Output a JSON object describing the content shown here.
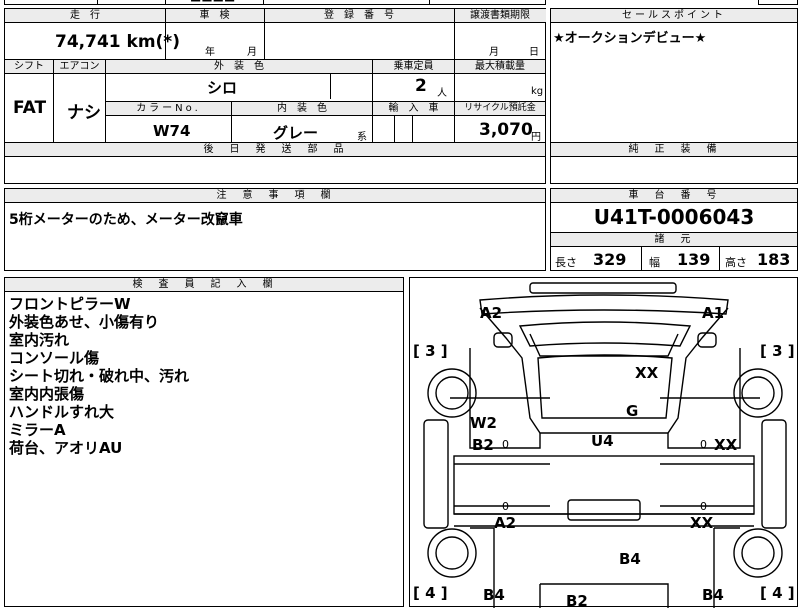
{
  "top_strip": {
    "partial_text": "■■■■"
  },
  "row1": {
    "mileage_label": "走　行",
    "mileage_value": "74,741 km(*)",
    "inspection_label": "車　検",
    "inspection_year": "年",
    "inspection_month": "月",
    "registration_label": "登　録　番　号",
    "registration_value": "",
    "transfer_label": "譲渡書類期限",
    "transfer_month": "月",
    "transfer_day": "日"
  },
  "row2": {
    "shift_label": "シフト",
    "shift_value": "FAT",
    "ac_label": "エアコン",
    "ac_value": "ナシ",
    "exterior_color_label": "外　装　色",
    "exterior_color_value": "シロ",
    "capacity_label": "乗車定員",
    "capacity_value": "2",
    "capacity_unit": "人",
    "max_load_label": "最大積載量",
    "max_load_unit": "kg",
    "color_no_label": "カラーNo.",
    "color_no_value": "W74",
    "interior_color_label": "内　装　色",
    "interior_color_value": "グレー",
    "interior_suffix": "系",
    "import_label": "輸　入　車",
    "recycle_label": "リサイクル預託金",
    "recycle_value": "3,070",
    "recycle_unit": "円"
  },
  "later_parts": {
    "label": "後　日　発　送　部　品",
    "value": ""
  },
  "sales_point": {
    "label": "セールスポイント",
    "value": "★オークションデビュー★"
  },
  "genuine_equipment": {
    "label": "純　正　装　備",
    "value": ""
  },
  "caution": {
    "label": "注　意　事　項　欄",
    "value": "5桁メーターのため、メーター改竄車"
  },
  "chassis": {
    "label": "車　台　番　号",
    "value": "U41T-0006043"
  },
  "specs": {
    "label": "諸　元",
    "length_label": "長さ",
    "length_value": "329",
    "width_label": "幅",
    "width_value": "139",
    "height_label": "高さ",
    "height_value": "183"
  },
  "inspector": {
    "label": "検　査　員　記　入　欄",
    "notes": [
      "フロントピラーW",
      "外装色あせ、小傷有り",
      "室内汚れ",
      "コンソール傷",
      "シート切れ・破れ中、汚れ",
      "室内内張傷",
      "ハンドルすれ大",
      "ミラーA",
      "荷台、アオリAU"
    ]
  },
  "diagram": {
    "marks": {
      "a2_top": "A2",
      "a1_top": "A1",
      "xx_hood": "XX",
      "g_center": "G",
      "w2": "W2",
      "b2_left": "B2",
      "u4": "U4",
      "xx_right": "XX",
      "a2_bottom": "A2",
      "xx_bottom": "XX",
      "b4_center": "B4",
      "b4_left": "B4",
      "b4_right": "B4",
      "b2_bottom": "B2"
    },
    "brackets": {
      "tl": "[ 3 ]",
      "tr": "[ 3 ]",
      "bl": "[ 4 ]",
      "br": "[ 4 ]"
    },
    "zeros": {
      "z1": "0",
      "z2": "0",
      "z3": "0",
      "z4": "0"
    }
  }
}
